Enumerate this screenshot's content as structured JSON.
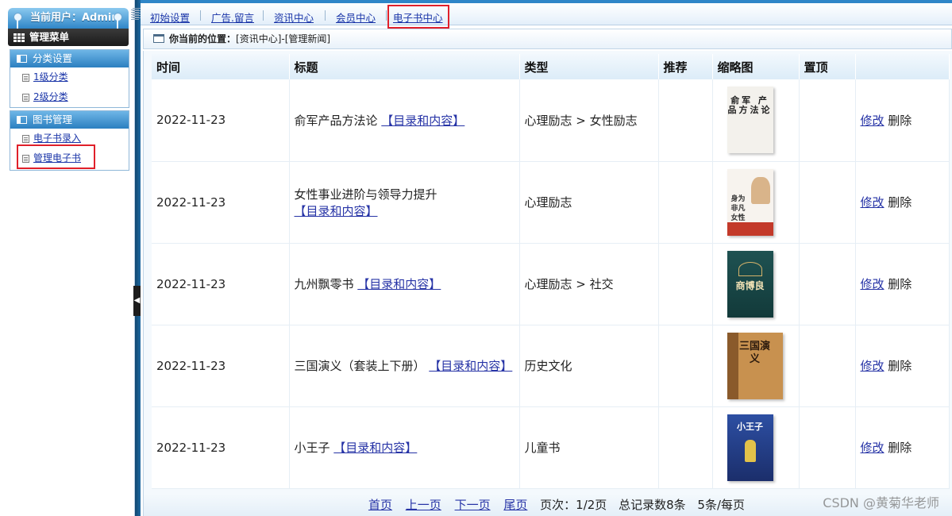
{
  "sidebar": {
    "user": "当前用户：Admin",
    "menu_title": "管理菜单",
    "groups": [
      {
        "title": "分类设置",
        "items": [
          "1级分类",
          "2级分类"
        ]
      },
      {
        "title": "图书管理",
        "items": [
          "电子书录入",
          "管理电子书"
        ]
      }
    ]
  },
  "topnav": {
    "items": [
      "初始设置",
      "广告.留言",
      "资讯中心",
      "会员中心",
      "电子书中心"
    ]
  },
  "breadcrumb": {
    "label": "你当前的位置：",
    "path": "[资讯中心]-[管理新闻]"
  },
  "table": {
    "headers": [
      "时间",
      "标题",
      "类型",
      "推荐",
      "缩略图",
      "置顶",
      ""
    ],
    "link_text": "【目录和内容】",
    "edit_label": "修改",
    "delete_label": "删除",
    "rows": [
      {
        "date": "2022-11-23",
        "title": "俞军产品方法论",
        "type": "心理励志 > 女性励志",
        "cover_text": "俞军 产品方法论"
      },
      {
        "date": "2022-11-23",
        "title": "女性事业进阶与领导力提升",
        "type": "心理励志",
        "cover_text": "身为 非凡女性"
      },
      {
        "date": "2022-11-23",
        "title": "九州飘零书",
        "type": "心理励志 > 社交",
        "cover_text": "商博良"
      },
      {
        "date": "2022-11-23",
        "title": "三国演义（套装上下册）",
        "type": "历史文化",
        "cover_text": "三国演义"
      },
      {
        "date": "2022-11-23",
        "title": "小王子",
        "type": "儿童书",
        "cover_text": "小王子"
      }
    ]
  },
  "pager": {
    "first": "首页",
    "prev": "上一页",
    "next": "下一页",
    "last": "尾页",
    "page_info": "页次：1/2页",
    "total": "总记录数8条",
    "per_page": "5条/每页"
  },
  "watermark": "CSDN @黄菊华老师",
  "colors": {
    "accent": "#2f86c8",
    "highlight_box": "#e0202a",
    "link": "#2633a6"
  }
}
